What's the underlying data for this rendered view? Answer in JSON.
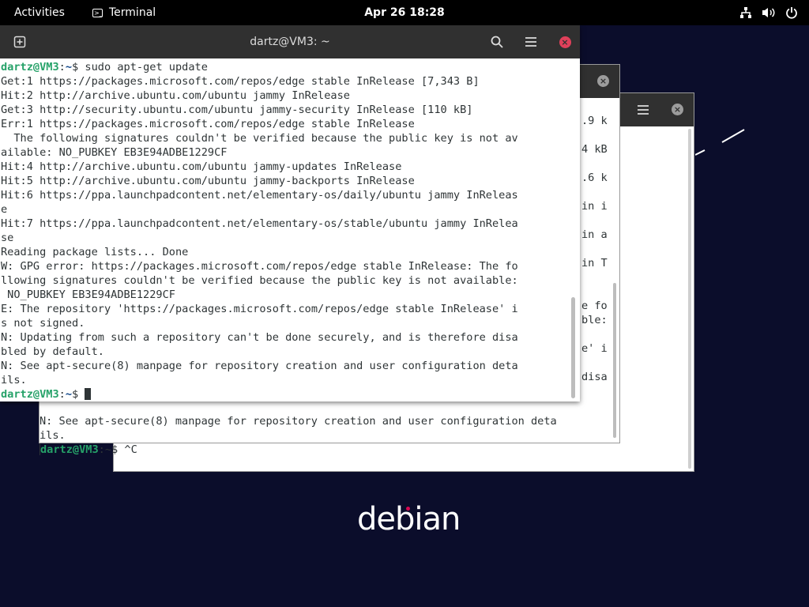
{
  "topbar": {
    "activities": "Activities",
    "app_name": "Terminal",
    "clock": "Apr 26  18:28"
  },
  "front_window": {
    "title": "dartz@VM3: ~",
    "lines": [
      [
        {
          "t": "dartz@VM3",
          "c": "u"
        },
        {
          "t": ":"
        },
        {
          "t": "~",
          "c": "p"
        },
        {
          "t": "$ sudo apt-get update"
        }
      ],
      [
        {
          "t": "Get:1 https://packages.microsoft.com/repos/edge stable InRelease [7,343 B]"
        }
      ],
      [
        {
          "t": "Hit:2 http://archive.ubuntu.com/ubuntu jammy InRelease"
        }
      ],
      [
        {
          "t": "Get:3 http://security.ubuntu.com/ubuntu jammy-security InRelease [110 kB]"
        }
      ],
      [
        {
          "t": "Err:1 https://packages.microsoft.com/repos/edge stable InRelease"
        }
      ],
      [
        {
          "t": "  The following signatures couldn't be verified because the public key is not av"
        }
      ],
      [
        {
          "t": "ailable: NO_PUBKEY EB3E94ADBE1229CF"
        }
      ],
      [
        {
          "t": "Hit:4 http://archive.ubuntu.com/ubuntu jammy-updates InRelease"
        }
      ],
      [
        {
          "t": "Hit:5 http://archive.ubuntu.com/ubuntu jammy-backports InRelease"
        }
      ],
      [
        {
          "t": "Hit:6 https://ppa.launchpadcontent.net/elementary-os/daily/ubuntu jammy InReleas"
        }
      ],
      [
        {
          "t": "e"
        }
      ],
      [
        {
          "t": "Hit:7 https://ppa.launchpadcontent.net/elementary-os/stable/ubuntu jammy InRelea"
        }
      ],
      [
        {
          "t": "se"
        }
      ],
      [
        {
          "t": "Reading package lists... Done"
        }
      ],
      [
        {
          "t": "W: GPG error: https://packages.microsoft.com/repos/edge stable InRelease: The fo"
        }
      ],
      [
        {
          "t": "llowing signatures couldn't be verified because the public key is not available:"
        }
      ],
      [
        {
          "t": " NO_PUBKEY EB3E94ADBE1229CF"
        }
      ],
      [
        {
          "t": "E: The repository 'https://packages.microsoft.com/repos/edge stable InRelease' i"
        }
      ],
      [
        {
          "t": "s not signed."
        }
      ],
      [
        {
          "t": "N: Updating from such a repository can't be done securely, and is therefore disa"
        }
      ],
      [
        {
          "t": "bled by default."
        }
      ],
      [
        {
          "t": "N: See apt-secure(8) manpage for repository creation and user configuration deta"
        }
      ],
      [
        {
          "t": "ils."
        }
      ],
      [
        {
          "t": "dartz@VM3",
          "c": "u"
        },
        {
          "t": ":"
        },
        {
          "t": "~",
          "c": "p"
        },
        {
          "t": "$ "
        },
        {
          "cursor": true
        }
      ]
    ]
  },
  "middle_window": {
    "edge_text": [
      ".9 k",
      "4 kB",
      ".6 k",
      "in i",
      "in a",
      "in T",
      "e fo",
      "ble:",
      "e' i",
      "disa"
    ],
    "lines": [
      {
        "text": "N: See apt-secure(8) manpage for repository creation and user configuration deta"
      },
      {
        "text": "ils."
      },
      {
        "prompt_user": "dartz@VM3",
        "prompt_rest": ":~$ ^C"
      }
    ]
  },
  "desktop": {
    "logo": "debian"
  },
  "colors": {
    "desktop_bg": "#0b0d2b",
    "topbar_bg": "#000000",
    "headerbar_bg": "#303030",
    "close_button": "#e0405a",
    "prompt_user": "#26a269",
    "prompt_path": "#12488b"
  },
  "icons": {
    "new_tab": "new-tab-icon",
    "search": "search-icon",
    "menu": "hamburger-menu-icon",
    "close": "close-icon",
    "network": "network-icon",
    "volume": "volume-icon",
    "power": "power-icon"
  }
}
